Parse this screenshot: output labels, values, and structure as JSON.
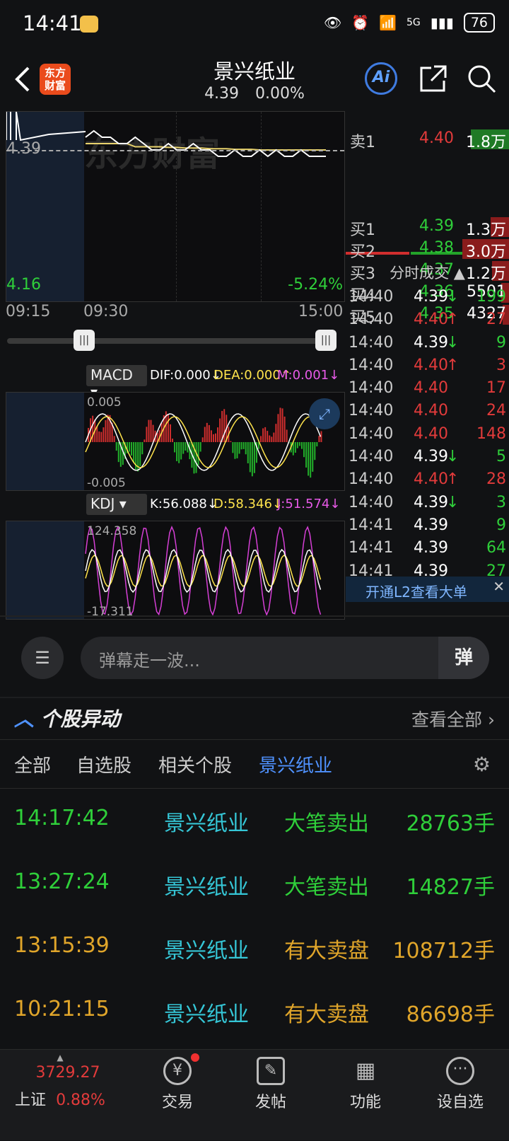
{
  "status": {
    "time": "14:41",
    "network": "5G",
    "battery": "76"
  },
  "header": {
    "title": "景兴纸业",
    "price": "4.39",
    "change": "0.00%",
    "logo_line1": "东方",
    "logo_line2": "财富",
    "ai_label": "Ai"
  },
  "chart": {
    "price_label": "4.39",
    "low_label": "4.16",
    "low_pct": "-5.24%",
    "watermark": "东方财富",
    "times": [
      "09:15",
      "09:30",
      "15:00"
    ],
    "price_series": [
      4.42,
      4.43,
      4.42,
      4.42,
      4.41,
      4.41,
      4.42,
      4.41,
      4.4,
      4.4,
      4.41,
      4.4,
      4.4,
      4.41,
      4.4,
      4.4,
      4.39,
      4.39,
      4.4,
      4.39,
      4.39,
      4.4,
      4.39,
      4.4,
      4.39,
      4.39,
      4.4,
      4.39,
      4.39,
      4.39
    ],
    "avg_series": [
      4.41,
      4.41,
      4.41,
      4.41,
      4.41,
      4.41,
      4.405,
      4.405,
      4.405,
      4.405,
      4.404,
      4.404,
      4.403,
      4.403,
      4.403,
      4.402,
      4.402,
      4.402,
      4.401,
      4.401,
      4.401,
      4.4,
      4.4,
      4.4,
      4.4,
      4.4,
      4.4,
      4.4,
      4.4,
      4.4
    ],
    "colors": {
      "up": "#e23b3b",
      "down": "#22c22c",
      "avg": "#e8d26c",
      "price": "#ffffff"
    }
  },
  "indicators": {
    "macd": {
      "name": "MACD",
      "dif": "DIF:0.000↓",
      "dea": "DEA:0.000↑",
      "m": "M:0.001↓",
      "top": "0.005",
      "bottom": "-0.005"
    },
    "kdj": {
      "name": "KDJ",
      "k": "K:56.088↓",
      "d": "D:58.346↓",
      "j": "J:51.574↓",
      "top": "124.358",
      "bottom": "-17.311"
    }
  },
  "orderbook": {
    "sell1": {
      "label": "卖1",
      "price": "4.40",
      "vol": "1.8万"
    },
    "buys": [
      {
        "label": "买1",
        "price": "4.39",
        "vol": "1.3万",
        "bar": 0.4
      },
      {
        "label": "买2",
        "price": "4.38",
        "vol": "3.0万",
        "bar": 1.0
      },
      {
        "label": "买3",
        "price": "4.37",
        "vol": "1.2万",
        "bar": 0.37
      },
      {
        "label": "买4",
        "price": "4.36",
        "vol": "5501",
        "bar": 0.17
      },
      {
        "label": "买5",
        "price": "4.35",
        "vol": "4327",
        "bar": 0.13
      }
    ],
    "trades_title": "分时成交",
    "trades": [
      {
        "time": "14:40",
        "price": "4.39",
        "arrow": "↓",
        "vol": "199",
        "pc": "w",
        "vc": "g"
      },
      {
        "time": "14:40",
        "price": "4.40",
        "arrow": "↑",
        "vol": "27",
        "pc": "r",
        "vc": "r"
      },
      {
        "time": "14:40",
        "price": "4.39",
        "arrow": "↓",
        "vol": "9",
        "pc": "w",
        "vc": "g"
      },
      {
        "time": "14:40",
        "price": "4.40",
        "arrow": "↑",
        "vol": "3",
        "pc": "r",
        "vc": "r"
      },
      {
        "time": "14:40",
        "price": "4.40",
        "arrow": "",
        "vol": "17",
        "pc": "r",
        "vc": "r"
      },
      {
        "time": "14:40",
        "price": "4.40",
        "arrow": "",
        "vol": "24",
        "pc": "r",
        "vc": "r"
      },
      {
        "time": "14:40",
        "price": "4.40",
        "arrow": "",
        "vol": "148",
        "pc": "r",
        "vc": "r"
      },
      {
        "time": "14:40",
        "price": "4.39",
        "arrow": "↓",
        "vol": "5",
        "pc": "w",
        "vc": "g"
      },
      {
        "time": "14:40",
        "price": "4.40",
        "arrow": "↑",
        "vol": "28",
        "pc": "r",
        "vc": "r"
      },
      {
        "time": "14:40",
        "price": "4.39",
        "arrow": "↓",
        "vol": "3",
        "pc": "w",
        "vc": "g"
      },
      {
        "time": "14:41",
        "price": "4.39",
        "arrow": "",
        "vol": "9",
        "pc": "w",
        "vc": "g"
      },
      {
        "time": "14:41",
        "price": "4.39",
        "arrow": "",
        "vol": "64",
        "pc": "w",
        "vc": "g"
      },
      {
        "time": "14:41",
        "price": "4.39",
        "arrow": "",
        "vol": "27",
        "pc": "w",
        "vc": "g"
      }
    ],
    "l2_banner": "开通L2查看大单"
  },
  "danmu": {
    "placeholder": "弹幕走一波...",
    "btn": "弹"
  },
  "events": {
    "title": "个股异动",
    "view_all": "查看全部",
    "tabs": [
      "全部",
      "自选股",
      "相关个股",
      "景兴纸业"
    ],
    "rows": [
      {
        "time": "14:17:42",
        "name": "景兴纸业",
        "type": "大笔卖出",
        "vol": "28763手",
        "color": "#2fcf3a"
      },
      {
        "time": "13:27:24",
        "name": "景兴纸业",
        "type": "大笔卖出",
        "vol": "14827手",
        "color": "#2fcf3a"
      },
      {
        "time": "13:15:39",
        "name": "景兴纸业",
        "type": "有大卖盘",
        "vol": "108712手",
        "color": "#e0a52a"
      },
      {
        "time": "10:21:15",
        "name": "景兴纸业",
        "type": "有大卖盘",
        "vol": "86698手",
        "color": "#e0a52a"
      }
    ]
  },
  "footer": {
    "index_value": "3729.27",
    "index_name": "上证",
    "index_pct": "0.88%",
    "tabs": [
      "交易",
      "发帖",
      "功能",
      "设自选"
    ]
  }
}
